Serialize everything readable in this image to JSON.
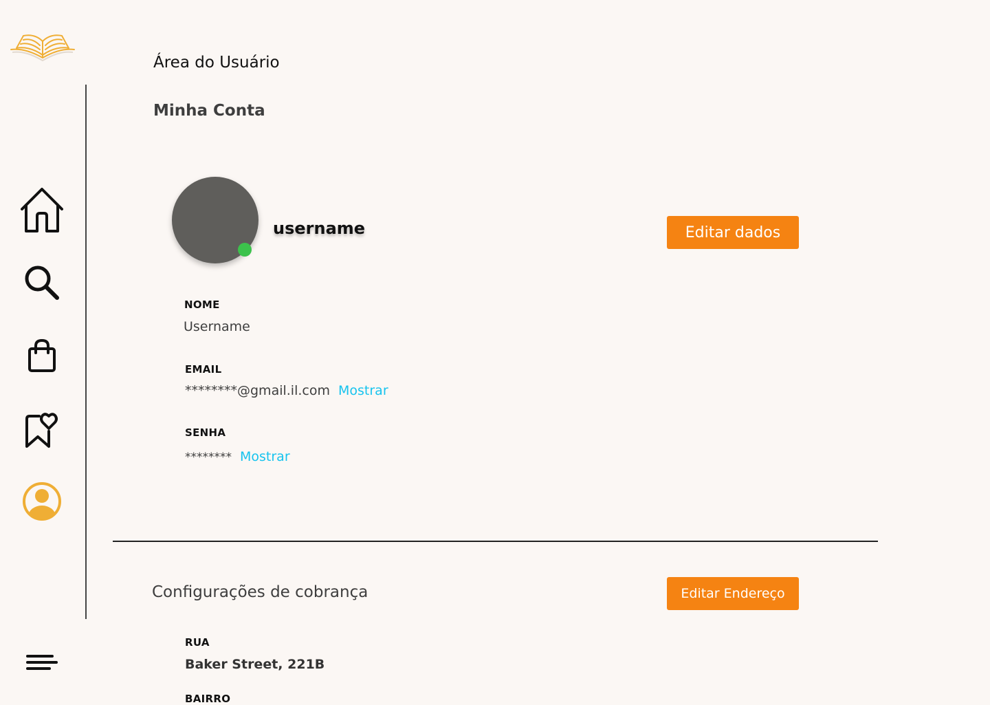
{
  "header": {
    "page_title": "Área do Usuário",
    "section_title": "Minha Conta"
  },
  "sidebar": {
    "items": [
      {
        "icon": "home-icon"
      },
      {
        "icon": "search-icon"
      },
      {
        "icon": "shopping-bag-icon"
      },
      {
        "icon": "bookmark-heart-icon"
      },
      {
        "icon": "user-circle-icon",
        "active": true
      }
    ],
    "menu_icon": "menu-icon",
    "logo_icon": "open-book-logo"
  },
  "profile": {
    "username": "username",
    "online_status_color": "#3cc24c",
    "edit_button_label": "Editar dados",
    "fields": {
      "nome": {
        "label": "NOME",
        "value": "Username"
      },
      "email": {
        "label": "EMAIL",
        "value": "********@gmail.il.com",
        "link": "Mostrar"
      },
      "senha": {
        "label": "SENHA",
        "value": "********",
        "link": "Mostrar"
      }
    }
  },
  "billing": {
    "title": "Configurações de cobrança",
    "edit_button_label": "Editar Endereço",
    "fields": {
      "rua": {
        "label": "RUA",
        "value": "Baker Street, 221B"
      },
      "bairro": {
        "label": "BAIRRO"
      }
    }
  },
  "colors": {
    "accent": "#f58312",
    "link": "#16c3ee",
    "active_icon": "#efae35",
    "background": "#fbf7f4"
  }
}
